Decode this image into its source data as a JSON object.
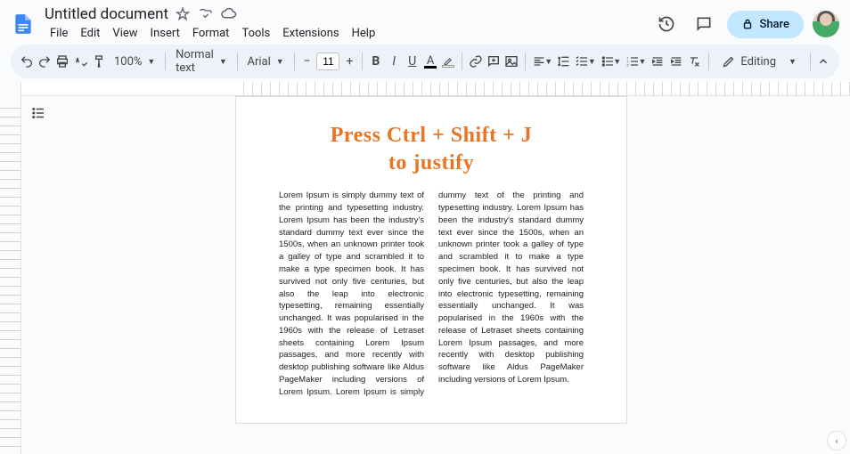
{
  "doc": {
    "title": "Untitled document"
  },
  "menu": {
    "file": "File",
    "edit": "Edit",
    "view": "View",
    "insert": "Insert",
    "format": "Format",
    "tools": "Tools",
    "extensions": "Extensions",
    "help": "Help"
  },
  "header": {
    "share": "Share"
  },
  "toolbar": {
    "zoom": "100%",
    "style": "Normal text",
    "font": "Arial",
    "size": "11",
    "mode": "Editing"
  },
  "content": {
    "heading_l1": "Press Ctrl + Shift + J",
    "heading_l2": "to justify",
    "body": "Lorem Ipsum is simply dummy text of the printing and typesetting industry. Lorem Ipsum has been the industry's standard dummy text ever since the 1500s, when an unknown printer took a galley of type and scrambled it to make a type specimen book. It has survived not only five centuries, but also the leap into electronic typesetting, remaining essentially unchanged. It was popularised in the 1960s with the release of Letraset sheets containing Lorem Ipsum passages, and more recently with desktop publishing software like Aldus PageMaker including versions of Lorem Ipsum. Lorem Ipsum is simply dummy text of the printing and typesetting industry. Lorem Ipsum has been the industry's standard dummy text ever since the 1500s, when an unknown printer took a galley of type and scrambled it to make a type specimen book. It has survived not only five centuries, but also the leap into electronic typesetting, remaining essentially unchanged. It was popularised in the 1960s with the release of Letraset sheets containing Lorem Ipsum passages, and more recently with desktop publishing software like Aldus PageMaker including versions of Lorem Ipsum."
  },
  "colors": {
    "accent": "#e87524",
    "share_bg": "#c2e7ff",
    "toolbar_bg": "#edf2fa"
  }
}
